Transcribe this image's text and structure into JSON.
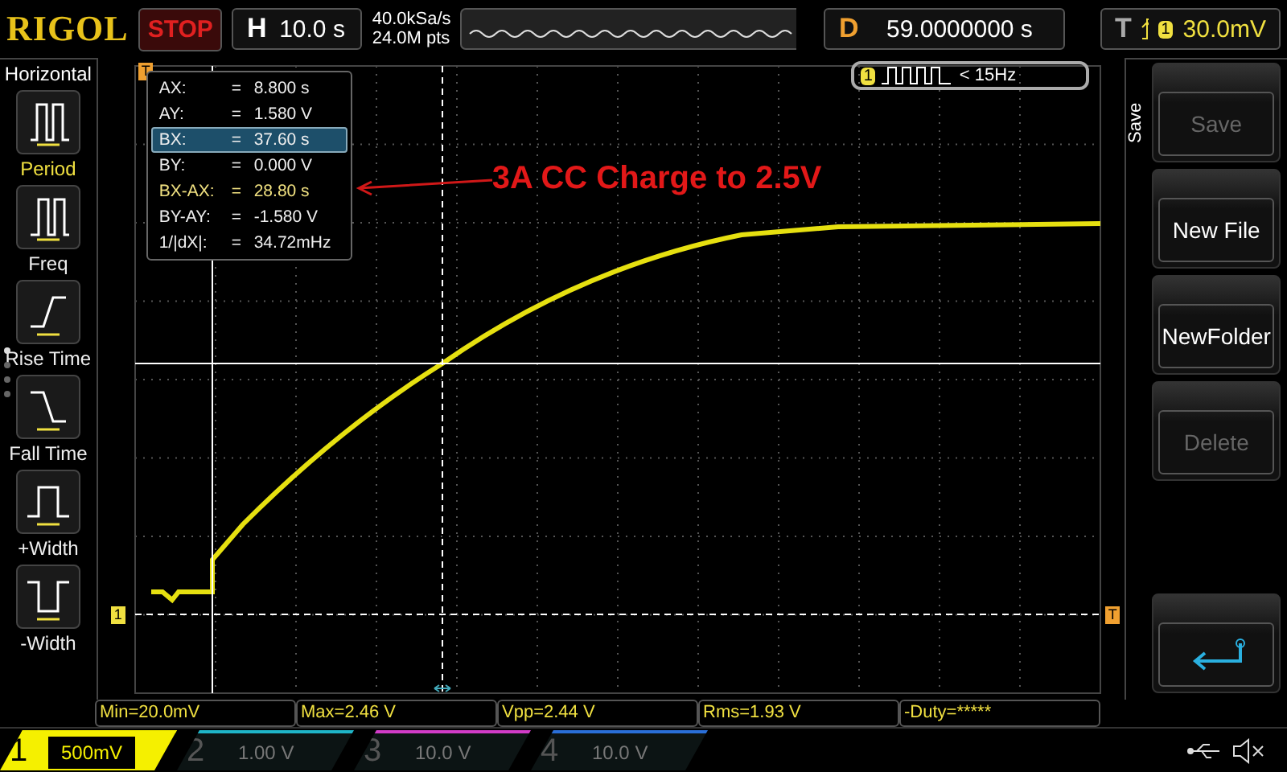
{
  "header": {
    "logo": "RIGOL",
    "run_state": "STOP",
    "timebase": {
      "label": "H",
      "value": "10.0 s"
    },
    "sample_rate": "40.0kSa/s",
    "memory_depth": "24.0M pts",
    "delay": {
      "label": "D",
      "value": "59.0000000 s"
    },
    "trigger": {
      "label": "T",
      "channel": "1",
      "level": "30.0mV"
    }
  },
  "left_menu": {
    "title": "Horizontal",
    "items": [
      {
        "label": "Period",
        "selected": true
      },
      {
        "label": "Freq",
        "selected": false
      },
      {
        "label": "Rise Time",
        "selected": false
      },
      {
        "label": "Fall Time",
        "selected": false
      },
      {
        "label": "+Width",
        "selected": false
      },
      {
        "label": "-Width",
        "selected": false
      }
    ]
  },
  "markers": {
    "trigger_position": "T",
    "channel_level": "1",
    "trigger_level": "T"
  },
  "cursor_readout": [
    {
      "label": "AX:",
      "eq": "=",
      "value": "8.800 s",
      "selected": false,
      "kind": "normal"
    },
    {
      "label": "AY:",
      "eq": "=",
      "value": "1.580 V",
      "selected": false,
      "kind": "normal"
    },
    {
      "label": "BX:",
      "eq": "=",
      "value": "37.60 s",
      "selected": true,
      "kind": "normal"
    },
    {
      "label": "BY:",
      "eq": "=",
      "value": "0.000 V",
      "selected": false,
      "kind": "normal"
    },
    {
      "label": "BX-AX:",
      "eq": "=",
      "value": "28.80 s",
      "selected": false,
      "kind": "delta"
    },
    {
      "label": "BY-AY:",
      "eq": "=",
      "value": "-1.580 V",
      "selected": false,
      "kind": "normal"
    },
    {
      "label": "1/|dX|:",
      "eq": "=",
      "value": "34.72mHz",
      "selected": false,
      "kind": "normal"
    }
  ],
  "annotation": "3A CC Charge to 2.5V",
  "trigger_badge": {
    "channel": "1",
    "text": "< 15Hz"
  },
  "right_menu": {
    "title": "Save",
    "buttons": [
      {
        "label": "Save",
        "disabled": true
      },
      {
        "label": "New File",
        "disabled": false
      },
      {
        "label": "NewFolder",
        "disabled": false
      },
      {
        "label": "Delete",
        "disabled": true
      }
    ]
  },
  "measurements": [
    "Min=20.0mV",
    "Max=2.46 V",
    "Vpp=2.44 V",
    "Rms=1.93 V",
    "-Duty=*****"
  ],
  "channels": [
    {
      "number": "1",
      "scale": "500mV",
      "active": true,
      "color": "#f5f000"
    },
    {
      "number": "2",
      "scale": "1.00 V",
      "active": false,
      "color": "#1fb5c8"
    },
    {
      "number": "3",
      "scale": "10.0 V",
      "active": false,
      "color": "#d23cc8"
    },
    {
      "number": "4",
      "scale": "10.0 V",
      "active": false,
      "color": "#2a6fd8"
    }
  ]
}
